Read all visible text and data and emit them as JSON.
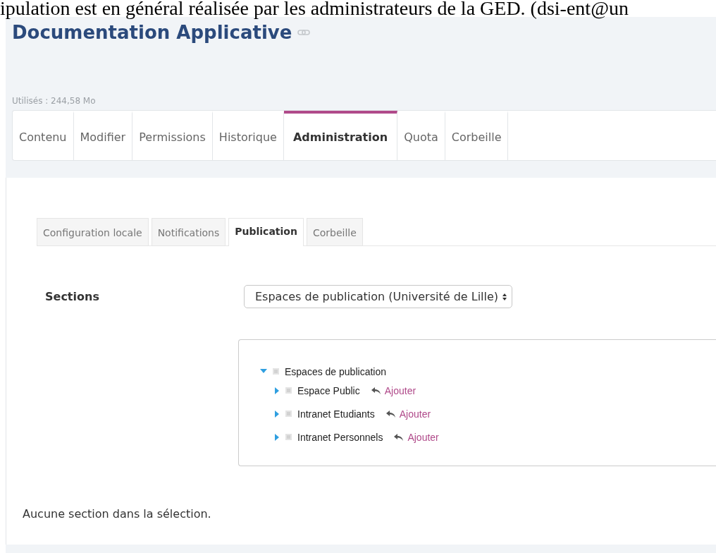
{
  "cut_text": "ipulation est en général réalisée par les administrateurs de la GED. (dsi-ent@un",
  "title": "Documentation Applicative",
  "quota_used": "Utilisés : 244,58 Mo",
  "tabs": [
    {
      "label": "Contenu",
      "selected": false
    },
    {
      "label": "Modifier",
      "selected": false
    },
    {
      "label": "Permissions",
      "selected": false
    },
    {
      "label": "Historique",
      "selected": false
    },
    {
      "label": "Administration",
      "selected": true
    },
    {
      "label": "Quota",
      "selected": false
    },
    {
      "label": "Corbeille",
      "selected": false
    }
  ],
  "subtabs": [
    {
      "label": "Configuration locale",
      "selected": false
    },
    {
      "label": "Notifications",
      "selected": false
    },
    {
      "label": "Publication",
      "selected": true
    },
    {
      "label": "Corbeille",
      "selected": false
    }
  ],
  "sections": {
    "label": "Sections",
    "select_value": "Espaces de publication (Université de Lille)"
  },
  "tree": [
    {
      "label": "Espaces de publication",
      "expanded": true,
      "children": [
        {
          "label": "Espace Public",
          "expanded": false,
          "action": "Ajouter"
        },
        {
          "label": "Intranet Etudiants",
          "expanded": false,
          "action": "Ajouter"
        },
        {
          "label": "Intranet Personnels",
          "expanded": false,
          "action": "Ajouter"
        }
      ]
    }
  ],
  "empty_message": "Aucune section dans la sélection."
}
